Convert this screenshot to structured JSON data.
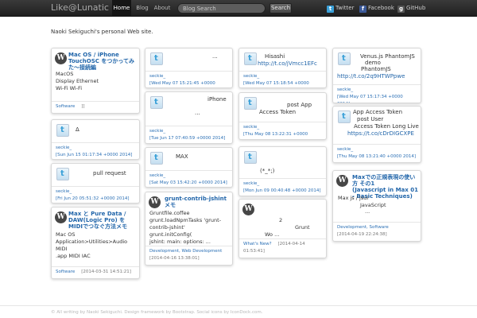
{
  "navbar": {
    "brand": "Like@Lunatic",
    "items": [
      "Home",
      "Blog",
      "About"
    ],
    "search_placeholder": "Blog Search",
    "search_button": "Search",
    "social": [
      {
        "label": "Twitter",
        "icon": "twitter-icon"
      },
      {
        "label": "Facebook",
        "icon": "facebook-icon"
      },
      {
        "label": "GitHub",
        "icon": "github-icon"
      }
    ]
  },
  "tagline": "Naoki Sekiguchi's personal Web site.",
  "cards": {
    "c1": {
      "title1": "Mac OS / iPhone",
      "title2": "TouchOSC をつかってみた〜接続編",
      "body": [
        "MacOS",
        "Display Ethernet",
        "Wi-Fi Wi-Fi"
      ],
      "tag": "Software",
      "date": "]]"
    },
    "c2": {
      "text": "Δ",
      "user": "seckie_",
      "date": "[Sun Jun 15 01:17:34 +0000 2014]"
    },
    "c3": {
      "text": "pull request",
      "user": "seckie_",
      "date": "[Fri Jun 20 05:51:32 +0000 2014]"
    },
    "c4": {
      "title1": "Max と Pure Data /",
      "title2": "DAW(Logic Pro) を",
      "title3": "MIDIでつなぐ方法メモ",
      "body": [
        "Mac OS",
        "Application>Utilities>Audio MIDI",
        ".app       MIDI        IAC"
      ],
      "tag": "Software",
      "date": "[2014-03-31 14:51:21]"
    },
    "c5": {
      "text": "...",
      "user": "seckie_",
      "date": "[Wed May 07 15:21:45 +0000 2014]"
    },
    "c6": {
      "text1": "iPhone",
      "text2": "...",
      "user": "seckie_",
      "date": "[Tue Jun 17 07:40:59 +0000 2014]"
    },
    "c7": {
      "text": "MAX",
      "user": "seckie_",
      "date": "[Sat May 03 15:42:20 +0000 2014]"
    },
    "c8": {
      "title1": "grunt-contrib-jshint",
      "title2": "メモ",
      "body": [
        "Gruntfile.coffee",
        "grunt.loadNpmTasks 'grunt-",
        "contrib-jshint' grunt.initConfig(",
        "jshint: main: options: ..."
      ],
      "tag": "Development, Web Development",
      "date": "[2014-04-16 13:38:01]"
    },
    "c9": {
      "text1": "Hisashi",
      "text2": "http://t.co/jVmcc1EFc",
      "user": "seckie_",
      "date": "[Wed May 07 15:18:54 +0000 2014]"
    },
    "c10": {
      "text1": "post App",
      "text2": "Access Token",
      "user": "seckie_",
      "date": "[Thu May 08 13:22:31 +0000 2014]"
    },
    "c11": {
      "text": "(*_*;)",
      "user": "seckie_",
      "date": "[Mon Jun 09 00:40:48 +0000 2014]"
    },
    "c12": {
      "body": [
        "2",
        "Grunt",
        "Wo ..."
      ],
      "tag": "What's New?",
      "date": "[2014-04-14 01:53:41]"
    },
    "c13": {
      "text1": "Venus.js PhantomJS",
      "text2": "demo",
      "text3": "PhantomJS",
      "text4": "http://t.co/2q9HTWPpwe",
      "user": "seckie_",
      "date": "[Wed May 07 15:17:34 +0000 2014]"
    },
    "c14": {
      "text1": "App Access Token",
      "text2": "post            User",
      "text3": "Access Token Long Live",
      "text4": "https://t.co/cDrDIGCXPE",
      "user": "seckie_",
      "date": "[Thu May 08 13:21:40 +0000 2014]"
    },
    "c15": {
      "title1": "Maxでの正規表現の使い方 その1",
      "title2": "(Javascript in Max 01",
      "title3": "- Basic Techniques)",
      "body": [
        "Max                  js / jsui",
        "JavaScript",
        "..."
      ],
      "tag": "Development, Software",
      "date": "[2014-04-19 22:24:38]"
    }
  },
  "footer": "© All writing by Naoki Sekiguchi.   Design framework by Bootstrap.   Social icons by IconDock.com.",
  "colors": {
    "accent_link": "#2266aa",
    "navbar_bg": "#2b2b2b",
    "twitter_blue": "#3aa0d8"
  }
}
